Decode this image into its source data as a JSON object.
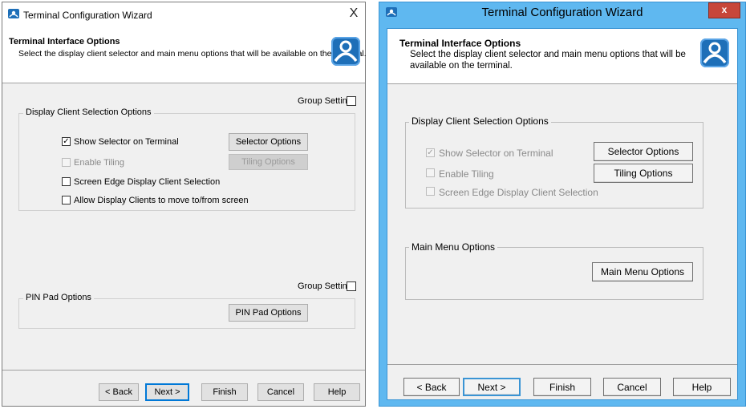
{
  "left": {
    "title": "Terminal Configuration Wizard",
    "close": "X",
    "header": {
      "title": "Terminal Interface Options",
      "subtitle": "Select the display client selector and main menu options that will be available on the terminal."
    },
    "group_setting_1": "Group Setting",
    "display_group": {
      "label": "Display Client Selection Options",
      "show_selector": "Show Selector on Terminal",
      "enable_tiling": "Enable Tiling",
      "screen_edge": "Screen Edge Display Client Selection",
      "allow_move": "Allow Display Clients to move to/from screen",
      "selector_button": "Selector Options",
      "tiling_button": "Tiling Options",
      "show_selector_checked": true
    },
    "group_setting_2": "Group Setting",
    "pin_group": {
      "label": "PIN Pad Options",
      "button": "PIN Pad Options"
    },
    "footer": {
      "back": "< Back",
      "next": "Next >",
      "finish": "Finish",
      "cancel": "Cancel",
      "help": "Help"
    }
  },
  "right": {
    "title": "Terminal Configuration Wizard",
    "close": "x",
    "header": {
      "title": "Terminal Interface Options",
      "subtitle_line1": "Select the display client selector and main menu options that will be",
      "subtitle_line2": "available on the terminal."
    },
    "display_group": {
      "label": "Display Client Selection Options",
      "show_selector": "Show Selector on Terminal",
      "enable_tiling": "Enable Tiling",
      "screen_edge": "Screen Edge Display Client Selection",
      "selector_button": "Selector Options",
      "tiling_button": "Tiling Options",
      "show_selector_checked": true
    },
    "main_menu_group": {
      "label": "Main Menu Options",
      "button": "Main Menu Options"
    },
    "footer": {
      "back": "< Back",
      "next": "Next >",
      "finish": "Finish",
      "cancel": "Cancel",
      "help": "Help"
    }
  },
  "colors": {
    "win8_frame": "#5fb8f0",
    "logo_blue": "#1e6fb8",
    "close_red": "#c7463a",
    "default_button_border": "#0078d7"
  },
  "icons": [
    "wizard-app-icon",
    "thinmanager-logo-icon",
    "close-icon",
    "checkbox-checked-icon"
  ]
}
